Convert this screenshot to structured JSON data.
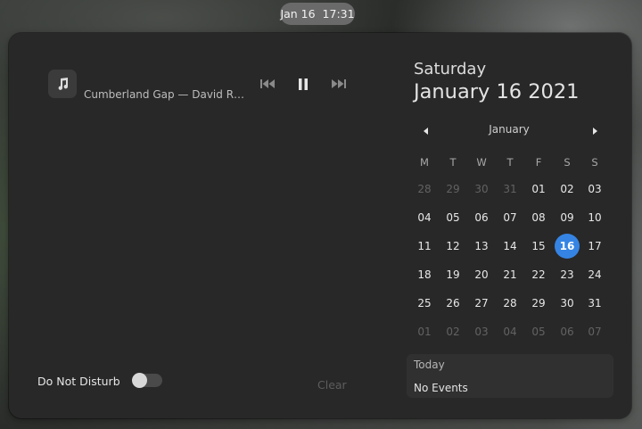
{
  "topbar": {
    "clock": "Jan 16  17:31"
  },
  "media": {
    "track": "Cumberland Gap — David R…",
    "icons": {
      "art": "music-note-icon",
      "prev": "skip-previous-icon",
      "play_pause": "pause-icon",
      "next": "skip-next-icon"
    }
  },
  "notifications": {
    "dnd_label": "Do Not Disturb",
    "dnd_enabled": false,
    "clear_label": "Clear"
  },
  "calendar": {
    "weekday": "Saturday",
    "full_date": "January 16 2021",
    "month": "January",
    "day_headers": [
      "M",
      "T",
      "W",
      "T",
      "F",
      "S",
      "S"
    ],
    "weeks": [
      [
        "28",
        "29",
        "30",
        "31",
        "01",
        "02",
        "03"
      ],
      [
        "04",
        "05",
        "06",
        "07",
        "08",
        "09",
        "10"
      ],
      [
        "11",
        "12",
        "13",
        "14",
        "15",
        "16",
        "17"
      ],
      [
        "18",
        "19",
        "20",
        "21",
        "22",
        "23",
        "24"
      ],
      [
        "25",
        "26",
        "27",
        "28",
        "29",
        "30",
        "31"
      ],
      [
        "01",
        "02",
        "03",
        "04",
        "05",
        "06",
        "07"
      ]
    ],
    "today": "16"
  },
  "events": {
    "title": "Today",
    "empty": "No Events"
  },
  "colors": {
    "accent": "#3584e4",
    "panel": "#282828"
  }
}
